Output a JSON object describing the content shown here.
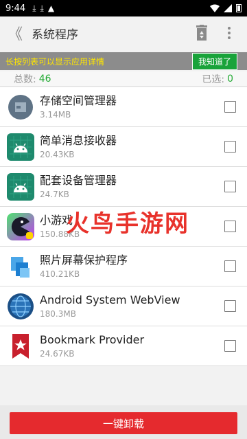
{
  "status_bar": {
    "time": "9:44"
  },
  "toolbar": {
    "back_glyph": "《",
    "title": "系统程序"
  },
  "banner": {
    "tip": "长按列表可以显示应用详情",
    "gotit_label": "我知道了"
  },
  "counts": {
    "total_label": "总数:",
    "total_value": "46",
    "selected_label": "已选:",
    "selected_value": "0"
  },
  "apps": [
    {
      "name": "存储空间管理器",
      "size": "3.14MB",
      "icon": "storage-manager-icon"
    },
    {
      "name": "简单消息接收器",
      "size": "20.43KB",
      "icon": "android-robot-icon"
    },
    {
      "name": "配套设备管理器",
      "size": "24.7KB",
      "icon": "android-robot-icon"
    },
    {
      "name": "小游戏",
      "size": "150.88KB",
      "icon": "mini-game-icon"
    },
    {
      "name": "照片屏幕保护程序",
      "size": "410.21KB",
      "icon": "photo-screensaver-icon"
    },
    {
      "name": "Android System WebView",
      "size": "180.3MB",
      "icon": "webview-globe-icon"
    },
    {
      "name": "Bookmark Provider",
      "size": "24.67KB",
      "icon": "bookmark-icon"
    }
  ],
  "watermark": "火鸟手游网",
  "footer": {
    "uninstall_label": "一键卸载"
  },
  "colors": {
    "accent_green": "#19a33a",
    "uninstall_red": "#e52a2e",
    "banner_yellow": "#ffe600"
  }
}
